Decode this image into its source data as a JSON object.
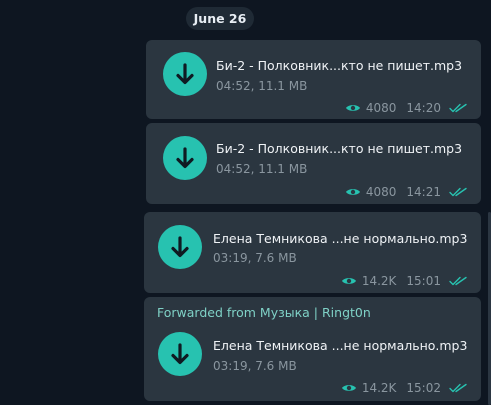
{
  "date_separator": "June 26",
  "messages": [
    {
      "forwarded_from": null,
      "file_name": "Би-2 - Полковник...кто не пишет.mp3",
      "file_meta": "04:52, 11.1 MB",
      "views": "4080",
      "time": "14:20"
    },
    {
      "forwarded_from": null,
      "file_name": "Би-2 - Полковник...кто не пишет.mp3",
      "file_meta": "04:52, 11.1 MB",
      "views": "4080",
      "time": "14:21"
    },
    {
      "forwarded_from": null,
      "file_name": "Елена Темникова ...не нормально.mp3",
      "file_meta": "03:19, 7.6 MB",
      "views": "14.2K",
      "time": "15:01"
    },
    {
      "forwarded_from": "Forwarded from Музыка | Ringt0n",
      "file_name": "Елена Темникова ...не нормально.mp3",
      "file_meta": "03:19, 7.6 MB",
      "views": "14.2K",
      "time": "15:02"
    }
  ],
  "colors": {
    "background": "#0e1621",
    "bubble": "#2b3640",
    "accent": "#27c2b0",
    "forward_label": "#7fd1c6"
  },
  "icons": {
    "download": "download-arrow-icon",
    "views": "eye-icon",
    "read_status": "double-check-icon"
  }
}
